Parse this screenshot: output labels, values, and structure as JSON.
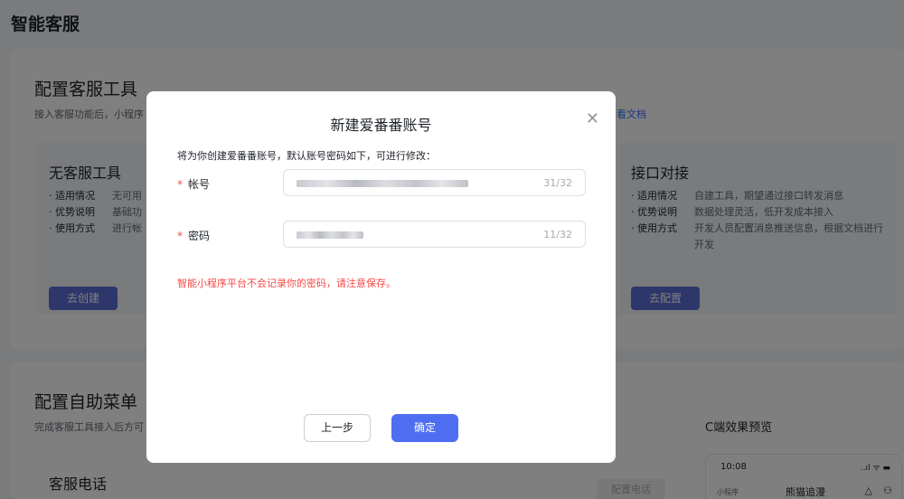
{
  "page": {
    "title": "智能客服"
  },
  "config_section": {
    "title": "配置客服工具",
    "desc": "接入客服功能后，小程序",
    "doc_link": "看文档",
    "tools": [
      {
        "title": "无客服工具",
        "rows": [
          {
            "k": "· 适用情况",
            "v": "无可用"
          },
          {
            "k": "· 优势说明",
            "v": "基础功"
          },
          {
            "k": "· 使用方式",
            "v": "进行帐"
          }
        ],
        "button": "去创建"
      },
      {
        "title": "接口对接",
        "rows": [
          {
            "k": "· 适用情况",
            "v": "自建工具，期望通过接口转发消息"
          },
          {
            "k": "· 优势说明",
            "v": "数据处理灵活，低开发成本接入"
          },
          {
            "k": "· 使用方式",
            "v": "开发人员配置消息推送信息，根据文档进行开发"
          }
        ],
        "button": "去配置"
      }
    ]
  },
  "menu_section": {
    "title": "配置自助菜单",
    "desc": "完成客服工具接入后方可",
    "preview_label": "C端效果预览",
    "phone_card_title": "客服电话",
    "phone_button": "配置电话",
    "preview": {
      "time": "10:08",
      "status": "..ıl ᯤ ▬",
      "mini_label": "小程序",
      "app_name": "熊猫追漫"
    }
  },
  "modal": {
    "title": "新建爱番番账号",
    "hint": "将为你创建爱番番账号，默认账号密码如下，可进行修改：",
    "fields": [
      {
        "label": "帐号",
        "required_mark": "*",
        "count": "31/32"
      },
      {
        "label": "密码",
        "required_mark": "*",
        "count": "11/32"
      }
    ],
    "warning": "智能小程序平台不会记录你的密码，请注意保存。",
    "prev_button": "上一步",
    "ok_button": "确定",
    "close_glyph": "✕"
  },
  "colors": {
    "primary": "#4e6ef2",
    "danger": "#f54a45",
    "link": "#3370ff"
  }
}
